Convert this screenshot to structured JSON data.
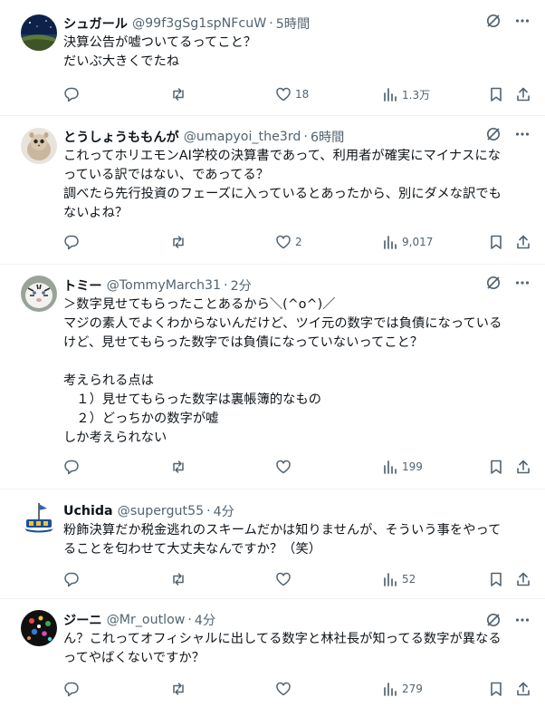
{
  "tweets": [
    {
      "name": "シュガール",
      "handle": "@99f3gSg1spNFcuW",
      "time": "5時間",
      "text": "決算公告が嘘ついてるってこと？\nだいぶ大きくでたね",
      "likes": "18",
      "views": "1.3万",
      "liked": false,
      "avatar_icon": "night-sky-avatar-icon"
    },
    {
      "name": "とうしょうももんが",
      "handle": "@umapyoi_the3rd",
      "time": "6時間",
      "text": "これってホリエモンAI学校の決算書であって、利用者が確実にマイナスにな\nっている訳ではない、であってる？\n調べたら先行投資のフェーズに入っているとあったから、別にダメな訳でも\nないよね？",
      "likes": "2",
      "views": "9,017",
      "avatar_icon": "flying-squirrel-avatar-icon"
    },
    {
      "name": "トミー",
      "handle": "@TommyMarch31",
      "time": "2分",
      "text": "＞数字見せてもらったことあるから＼(^o^)／\nマジの素人でよくわからないんだけど、ツイ元の数字では負債になっている\nけど、見せてもらった数字では負債になっていないってこと？\n\n考えられる点は\n　１）見せてもらった数字は裏帳簿的なもの\n　２）どっちかの数字が嘘\nしか考えられない",
      "likes": "",
      "views": "199",
      "avatar_icon": "white-tiger-avatar-icon"
    },
    {
      "name": "Uchida",
      "handle": "@supergut55",
      "time": "4分",
      "text": "粉飾決算だか税金逃れのスキームだかは知りませんが、そういう事をやって\nることを匂わせて大丈夫なんですか？（笑）",
      "likes": "",
      "views": "52",
      "avatar_icon": "ship-avatar-icon"
    },
    {
      "name": "ジーニ",
      "handle": "@Mr_outlow",
      "time": "4分",
      "text": "ん？これってオフィシャルに出してる数字と林社長が知ってる数字が異なる\nってやばくないですか？",
      "likes": "",
      "views": "279",
      "avatar_icon": "colorful-dots-avatar-icon"
    }
  ],
  "icons": {
    "grok": "grok-icon",
    "more": "more-icon",
    "reply": "reply-icon",
    "repost": "repost-icon",
    "like": "like-icon",
    "views": "views-icon",
    "bookmark": "bookmark-icon",
    "share": "share-icon"
  },
  "colors": {
    "text": "#0f1419",
    "secondary": "#536471",
    "divider": "#eff3f4"
  }
}
